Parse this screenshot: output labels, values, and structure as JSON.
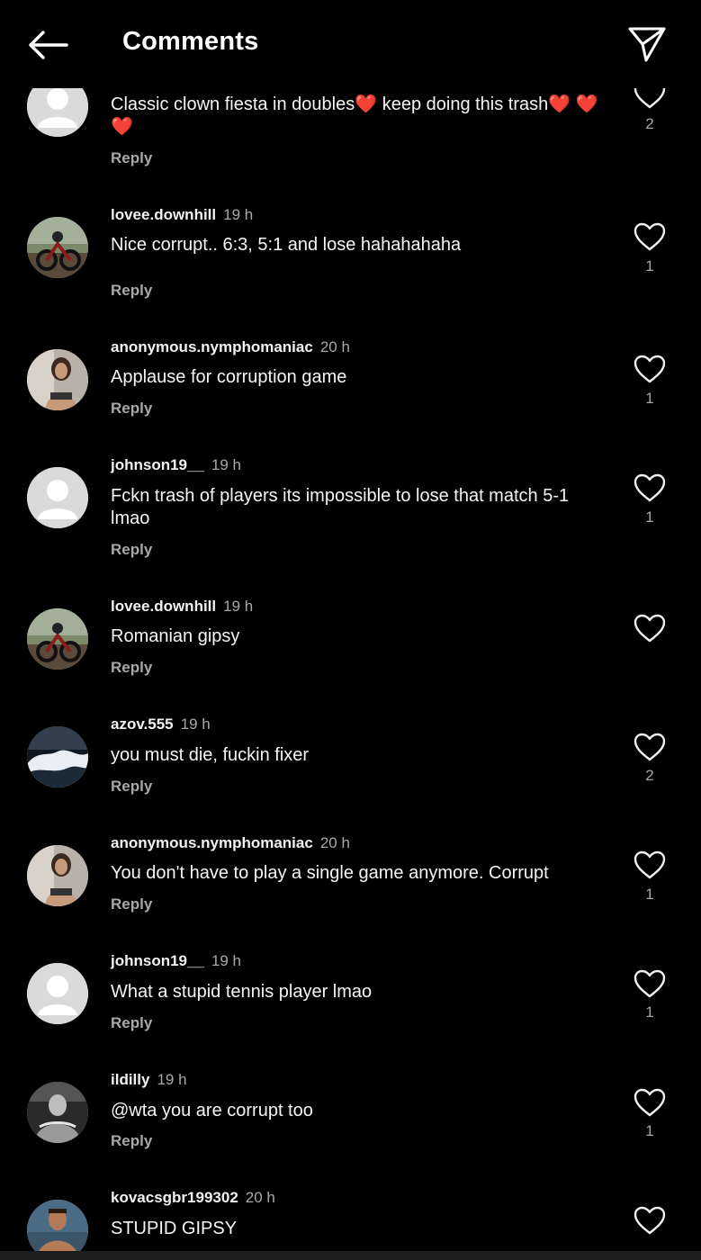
{
  "header": {
    "title": "Comments"
  },
  "comments": [
    {
      "username": "",
      "time": "",
      "text": "Classic clown fiesta in doubles❤️ keep doing this trash❤️ ❤️❤️",
      "reply_label": "Reply",
      "likes": "2",
      "avatar": "default"
    },
    {
      "username": "lovee.downhill",
      "time": "19 h",
      "text": "Nice corrupt.. 6:3, 5:1 and lose hahahahaha",
      "reply_label": "Reply",
      "likes": "1",
      "avatar": "bike"
    },
    {
      "username": "anonymous.nymphomaniac",
      "time": "20 h",
      "text": "Applause for corruption game",
      "reply_label": "Reply",
      "likes": "1",
      "avatar": "person"
    },
    {
      "username": "johnson19__",
      "time": "19 h",
      "text": "Fckn trash of players its impossible to lose that match 5-1 lmao",
      "reply_label": "Reply",
      "likes": "1",
      "avatar": "default"
    },
    {
      "username": "lovee.downhill",
      "time": "19 h",
      "text": "Romanian gipsy",
      "reply_label": "Reply",
      "likes": "",
      "avatar": "bike"
    },
    {
      "username": "azov.555",
      "time": "19 h",
      "text": "you must die, fuckin fixer",
      "reply_label": "Reply",
      "likes": "2",
      "avatar": "wave"
    },
    {
      "username": "anonymous.nymphomaniac",
      "time": "20 h",
      "text": "You don't have to play a single game anymore. Corrupt",
      "reply_label": "Reply",
      "likes": "1",
      "avatar": "person"
    },
    {
      "username": "johnson19__",
      "time": "19 h",
      "text": "What a stupid tennis player lmao",
      "reply_label": "Reply",
      "likes": "1",
      "avatar": "default"
    },
    {
      "username": "ildilly",
      "time": "19 h",
      "text": "@wta  you are corrupt too",
      "reply_label": "Reply",
      "likes": "1",
      "avatar": "bw"
    },
    {
      "username": "kovacsgbr199302",
      "time": "20 h",
      "text": "STUPID GIPSY",
      "reply_label": "",
      "likes": "",
      "avatar": "man"
    }
  ]
}
